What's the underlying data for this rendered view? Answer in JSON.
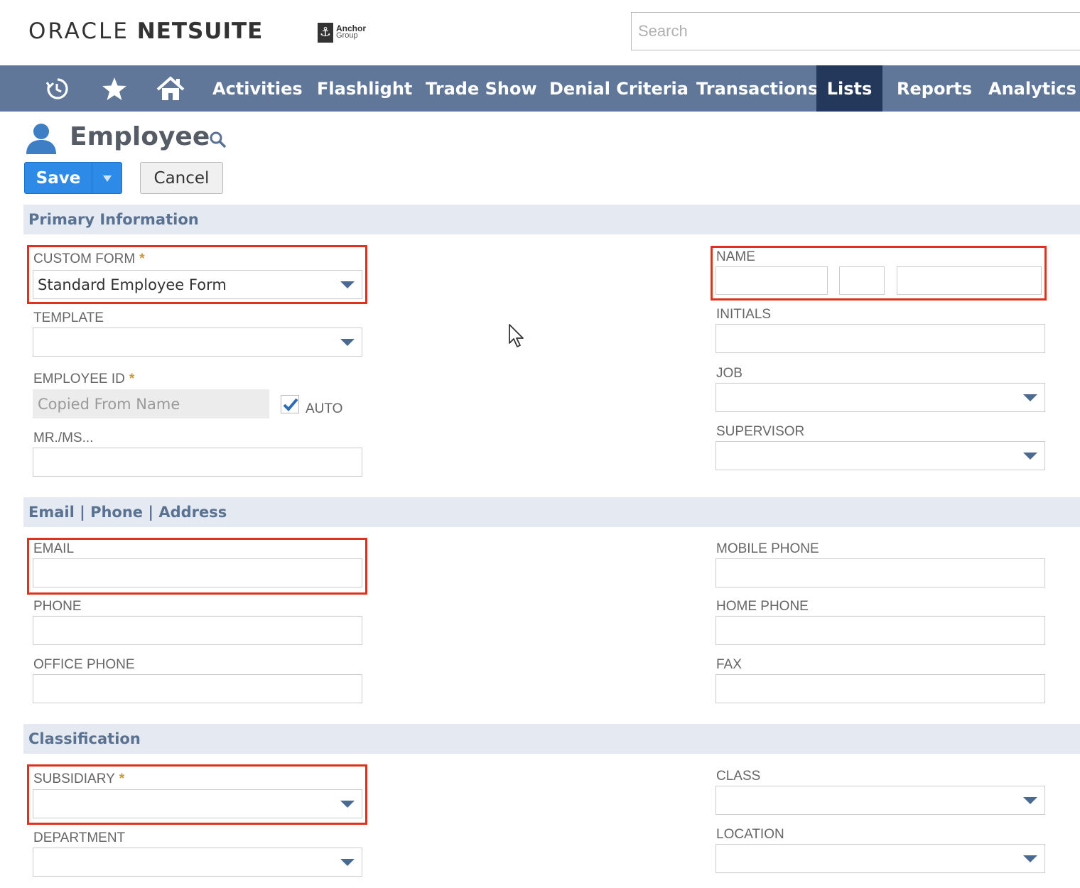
{
  "header": {
    "logo_oracle": "ORACLE",
    "logo_netsuite": "NETSUITE",
    "partner_line1": "Anchor",
    "partner_line2": "Group",
    "search_placeholder": "Search"
  },
  "nav": {
    "icons": [
      "recent-records-icon",
      "favorites-star-icon",
      "home-icon"
    ],
    "items": [
      {
        "label": "Activities",
        "active": false
      },
      {
        "label": "Flashlight",
        "active": false
      },
      {
        "label": "Trade Show",
        "active": false
      },
      {
        "label": "Denial Criteria",
        "active": false
      },
      {
        "label": "Transactions",
        "active": false
      },
      {
        "label": "Lists",
        "active": true
      },
      {
        "label": "Reports",
        "active": false
      },
      {
        "label": "Analytics",
        "active": false
      }
    ],
    "bar_color": "#607799",
    "active_color": "#24385b"
  },
  "page": {
    "title": "Employee",
    "save_label": "Save",
    "cancel_label": "Cancel",
    "required_marker": "*"
  },
  "sections": {
    "primary": "Primary Information",
    "contact": "Email | Phone | Address",
    "classification": "Classification"
  },
  "fields": {
    "custom_form": {
      "label": "CUSTOM FORM",
      "value": "Standard Employee Form"
    },
    "template": {
      "label": "TEMPLATE",
      "value": ""
    },
    "employee_id": {
      "label": "EMPLOYEE ID",
      "placeholder": "Copied From Name",
      "auto_label": "AUTO",
      "auto_checked": true
    },
    "mr_ms": {
      "label": "MR./MS...",
      "value": ""
    },
    "name": {
      "label": "NAME"
    },
    "initials": {
      "label": "INITIALS"
    },
    "job": {
      "label": "JOB"
    },
    "supervisor": {
      "label": "SUPERVISOR"
    },
    "email": {
      "label": "EMAIL"
    },
    "phone": {
      "label": "PHONE"
    },
    "office_phone": {
      "label": "OFFICE PHONE"
    },
    "mobile_phone": {
      "label": "MOBILE PHONE"
    },
    "home_phone": {
      "label": "HOME PHONE"
    },
    "fax": {
      "label": "FAX"
    },
    "subsidiary": {
      "label": "SUBSIDIARY"
    },
    "department": {
      "label": "DEPARTMENT"
    },
    "class": {
      "label": "CLASS"
    },
    "location": {
      "label": "LOCATION"
    }
  },
  "colors": {
    "accent_blue": "#2d8ae6",
    "highlight_red": "#e0301e",
    "section_bg": "#e5e9f1",
    "required_gold": "#c79a3a"
  }
}
